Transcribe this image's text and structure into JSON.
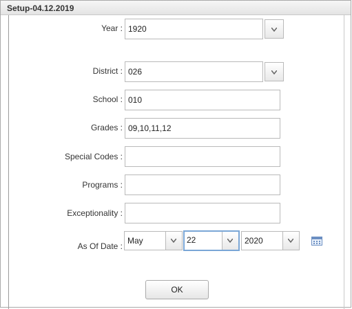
{
  "window": {
    "title": "Setup-04.12.2019"
  },
  "form": {
    "year": {
      "label": "Year :",
      "value": "1920"
    },
    "district": {
      "label": "District :",
      "value": "026"
    },
    "school": {
      "label": "School :",
      "value": "010"
    },
    "grades": {
      "label": "Grades :",
      "value": "09,10,11,12"
    },
    "special_codes": {
      "label": "Special Codes :",
      "value": ""
    },
    "programs": {
      "label": "Programs :",
      "value": ""
    },
    "exceptionality": {
      "label": "Exceptionality :",
      "value": ""
    },
    "as_of_date": {
      "label": "As Of Date :",
      "month": "May",
      "day": "22",
      "year": "2020"
    }
  },
  "buttons": {
    "ok": "OK"
  },
  "icons": {
    "dropdown": "chevron-down-icon",
    "calendar": "calendar-icon"
  },
  "colors": {
    "focus_border": "#7aa6d6",
    "calendar_blue": "#6b8fc2"
  }
}
